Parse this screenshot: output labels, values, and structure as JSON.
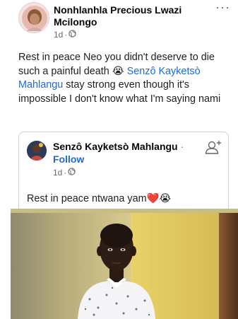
{
  "post": {
    "author": "Nonhlanhla Precious Lwazi Mcilongo",
    "time": "1d",
    "separator": "·",
    "more_icon": "more-horizontal-icon",
    "text_before": "Rest in peace Neo you didn't deserve to die such a painful death ",
    "emoji_crying": "😭",
    "mention": "Senzô Kayketsò Mahlangu",
    "text_after": " stay strong even though it's impossible I don't know what I'm saying nami"
  },
  "shared": {
    "author": "Senzô Kayketsò Mahlangu",
    "separator": "·",
    "follow_label": "Follow",
    "time": "1d",
    "text": "Rest in peace ntwana yam",
    "emoji_heart": "❤️",
    "emoji_crying": "😭"
  },
  "colors": {
    "link": "#1b6ad8",
    "meta": "#65676b",
    "border": "#ced0d4",
    "wall_sunlit": "#e9d26a",
    "wall_shade": "#8f8a6e",
    "door": "#6b4328"
  },
  "icons": [
    "globe-icon",
    "add-friend-icon",
    "more-horizontal-icon"
  ]
}
